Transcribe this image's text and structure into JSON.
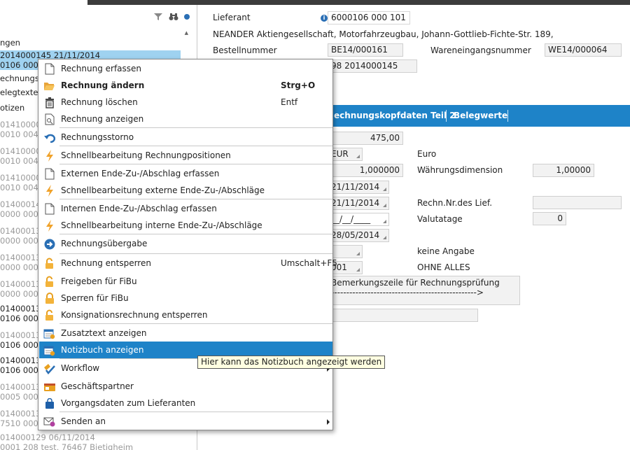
{
  "left_panel": {
    "lines": [
      {
        "text": "ngen",
        "style": "normal"
      },
      {
        "text": "2014000145 21/11/2014",
        "style": "sel"
      },
      {
        "text": "0106 000",
        "style": "sel"
      },
      {
        "text": "echnungs",
        "style": "normal"
      },
      {
        "text": "elegtexte",
        "style": "normal"
      },
      {
        "text": "otizen",
        "style": "normal"
      },
      {
        "text": "01410000",
        "style": "grey"
      },
      {
        "text": "0010 004",
        "style": "grey"
      },
      {
        "text": "01410000",
        "style": "grey"
      },
      {
        "text": "0010 004",
        "style": "grey"
      },
      {
        "text": "01410000",
        "style": "grey"
      },
      {
        "text": "0010 004",
        "style": "grey"
      },
      {
        "text": "01400014",
        "style": "grey"
      },
      {
        "text": "0000 000",
        "style": "grey"
      },
      {
        "text": "01400013",
        "style": "grey"
      },
      {
        "text": "0000 000",
        "style": "grey"
      },
      {
        "text": "01400013",
        "style": "grey"
      },
      {
        "text": "0000 000",
        "style": "grey"
      },
      {
        "text": "01400013",
        "style": "grey"
      },
      {
        "text": "0000 000",
        "style": "grey"
      },
      {
        "text": "01400013",
        "style": "normal"
      },
      {
        "text": "0106 000",
        "style": "normal"
      },
      {
        "text": "01400013",
        "style": "grey"
      },
      {
        "text": "0106 000",
        "style": "normal"
      },
      {
        "text": "01400013",
        "style": "normal"
      },
      {
        "text": "0106 000",
        "style": "normal"
      },
      {
        "text": "01400013",
        "style": "grey"
      },
      {
        "text": "0005 000",
        "style": "grey"
      },
      {
        "text": "01400013",
        "style": "grey"
      },
      {
        "text": "7510 000",
        "style": "grey"
      },
      {
        "text": "014000129 06/11/2014",
        "style": "grey"
      },
      {
        "text": "0001 208 test, 76467 Bietigheim",
        "style": "grey"
      }
    ]
  },
  "header": {
    "lieferant_label": "Lieferant",
    "lieferant_value": "6000106 000 101",
    "address": "NEANDER Aktiengesellschaft, Motorfahrzeugbau, Johann-Gottlieb-Fichte-Str. 189,",
    "bestellnummer_label": "Bestellnummer",
    "bestellnummer_value": "BE14/000161",
    "wareneingang_label": "Wareneingangsnummer",
    "wareneingang_value": "WE14/000064",
    "partial_value": "98  2014000145"
  },
  "tabs": [
    {
      "label": "echnungskopfdaten Teil 2"
    },
    {
      "label": "Belegwerte"
    }
  ],
  "form": {
    "amount": "475,00",
    "currency_code": "EUR",
    "currency_label": "Euro",
    "rate": "1,000000",
    "waehrungsdim_label": "Währungsdimension",
    "waehrungsdim_value": "1,00000",
    "date1": "21/11/2014",
    "date2": "21/11/2014",
    "rechn_nr_label": "Rechn.Nr.des Lief.",
    "rechn_nr_value": "",
    "date_empty": "__/__/____",
    "valutatage_label": "Valutatage",
    "valutatage_value": "0",
    "date3": "28/05/2014",
    "keine_angabe": "keine Angabe",
    "code_001": "001",
    "ohne_alles": "OHNE ALLES",
    "bemerkung_line1": "Bemerkungszeile für Rechnungsprüfung",
    "bemerkung_line2": "------------------------------------------------>"
  },
  "context_menu": {
    "items": [
      {
        "label": "Rechnung erfassen",
        "shortcut": "",
        "icon": "document-icon",
        "bold": false,
        "submenu": false,
        "highlighted": false
      },
      {
        "label": "Rechnung ändern",
        "shortcut": "Strg+O",
        "icon": "folder-open-icon",
        "bold": true,
        "submenu": false,
        "highlighted": false
      },
      {
        "label": "Rechnung löschen",
        "shortcut": "Entf",
        "icon": "trash-icon",
        "bold": false,
        "submenu": false,
        "highlighted": false
      },
      {
        "label": "Rechnung anzeigen",
        "shortcut": "",
        "icon": "document-view-icon",
        "bold": false,
        "submenu": false,
        "highlighted": false
      },
      {
        "label": "Rechnungsstorno",
        "shortcut": "",
        "icon": "undo-arrow-icon",
        "bold": false,
        "submenu": false,
        "highlighted": false
      },
      {
        "label": "Schnellbearbeitung Rechnungpositionen",
        "shortcut": "",
        "icon": "lightning-icon",
        "bold": false,
        "submenu": false,
        "highlighted": false
      },
      {
        "label": "Externen Ende-Zu-/Abschlag erfassen",
        "shortcut": "",
        "icon": "document-icon",
        "bold": false,
        "submenu": false,
        "highlighted": false
      },
      {
        "label": "Schnellbearbeitung externe Ende-Zu-/Abschläge",
        "shortcut": "",
        "icon": "lightning-icon",
        "bold": false,
        "submenu": false,
        "highlighted": false
      },
      {
        "label": "Internen Ende-Zu-/Abschlag erfassen",
        "shortcut": "",
        "icon": "document-icon",
        "bold": false,
        "submenu": false,
        "highlighted": false
      },
      {
        "label": "Schnellbearbeitung interne Ende-Zu-/Abschläge",
        "shortcut": "",
        "icon": "lightning-icon",
        "bold": false,
        "submenu": false,
        "highlighted": false
      },
      {
        "label": "Rechnungsübergabe",
        "shortcut": "",
        "icon": "arrow-right-circle-icon",
        "bold": false,
        "submenu": false,
        "highlighted": false
      },
      {
        "label": "Rechnung entsperren",
        "shortcut": "Umschalt+F5",
        "icon": "unlock-icon",
        "bold": false,
        "submenu": false,
        "highlighted": false
      },
      {
        "label": "Freigeben für FiBu",
        "shortcut": "",
        "icon": "unlock-icon",
        "bold": false,
        "submenu": false,
        "highlighted": false
      },
      {
        "label": "Sperren für FiBu",
        "shortcut": "",
        "icon": "lock-icon",
        "bold": false,
        "submenu": false,
        "highlighted": false
      },
      {
        "label": "Konsignationsrechnung entsperren",
        "shortcut": "",
        "icon": "unlock-icon",
        "bold": false,
        "submenu": false,
        "highlighted": false
      },
      {
        "label": "Zusatztext anzeigen",
        "shortcut": "",
        "icon": "calendar-note-icon",
        "bold": false,
        "submenu": false,
        "highlighted": false
      },
      {
        "label": "Notizbuch anzeigen",
        "shortcut": "",
        "icon": "calendar-note-icon",
        "bold": false,
        "submenu": false,
        "highlighted": true
      },
      {
        "label": "Workflow",
        "shortcut": "",
        "icon": "workflow-icon",
        "bold": false,
        "submenu": true,
        "highlighted": false
      },
      {
        "label": "Geschäftspartner",
        "shortcut": "",
        "icon": "contact-card-icon",
        "bold": false,
        "submenu": false,
        "highlighted": false
      },
      {
        "label": "Vorgangsdaten zum Lieferanten",
        "shortcut": "",
        "icon": "shopping-bag-icon",
        "bold": false,
        "submenu": false,
        "highlighted": false
      },
      {
        "label": "Senden an",
        "shortcut": "",
        "icon": "send-envelope-icon",
        "bold": false,
        "submenu": true,
        "highlighted": false
      }
    ]
  },
  "tooltip": {
    "text": "Hier kann das Notizbuch angezeigt werden"
  },
  "colors": {
    "accent": "#1e83c8",
    "selection": "#9fd2f0",
    "tooltip_bg": "#ffffe1"
  }
}
